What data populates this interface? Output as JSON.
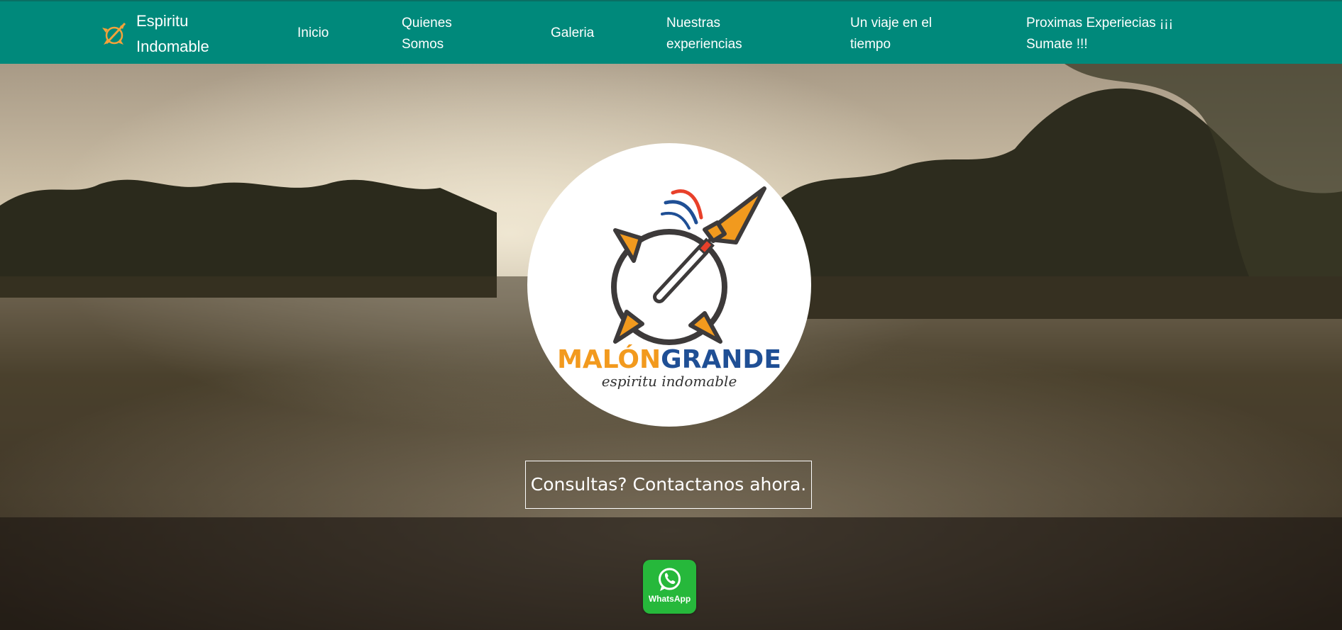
{
  "navbar": {
    "brand_name": "Espiritu\nIndomable",
    "brand_icon": "spear-compass-icon",
    "links": [
      {
        "label": "Inicio"
      },
      {
        "label": "Quienes\nSomos"
      },
      {
        "label": "Galeria"
      },
      {
        "label": "Nuestras\nexperiencias"
      },
      {
        "label": "Un viaje en el\ntiempo"
      },
      {
        "label": "Proximas Experiecias ¡¡¡\nSumate !!!"
      }
    ],
    "background_color": "#00897b"
  },
  "hero": {
    "logo": {
      "word_part1": "MALÓN",
      "word_part2": "GRANDE",
      "tagline": "espiritu indomable",
      "colors": {
        "orange": "#f29a1e",
        "blue": "#1f4f95",
        "red": "#e8402a"
      }
    },
    "cta_label": "Consultas? Contactanos ahora.",
    "whatsapp": {
      "label": "WhatsApp",
      "icon": "whatsapp-icon",
      "color": "#26b83b"
    }
  }
}
